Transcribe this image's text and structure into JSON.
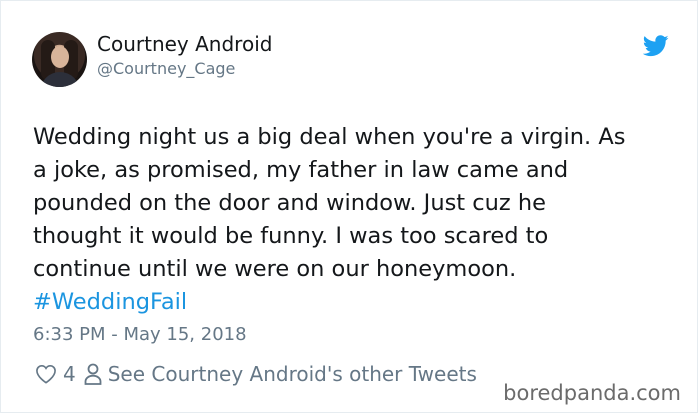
{
  "user": {
    "name": "Courtney Android",
    "handle": "@Courtney_Cage"
  },
  "tweet": {
    "lines": [
      "Wedding night us a big deal when you're a virgin. As",
      "a joke, as promised, my father in law came and",
      "pounded on the door and window. Just cuz he",
      "thought it would be funny. I was too scared to",
      "continue until we were on our honeymoon."
    ],
    "hashtag": "#WeddingFail",
    "timestamp": "6:33 PM - May 15, 2018"
  },
  "actions": {
    "like_count": "4",
    "other_tweets_label": "See Courtney Android's other Tweets"
  },
  "watermark": "boredpanda.com",
  "icons": {
    "brand": "twitter-bird-icon",
    "like": "heart-icon",
    "profile": "person-icon"
  },
  "colors": {
    "accent": "#1b95e0",
    "secondary_text": "#657786",
    "primary_text": "#14171a"
  }
}
